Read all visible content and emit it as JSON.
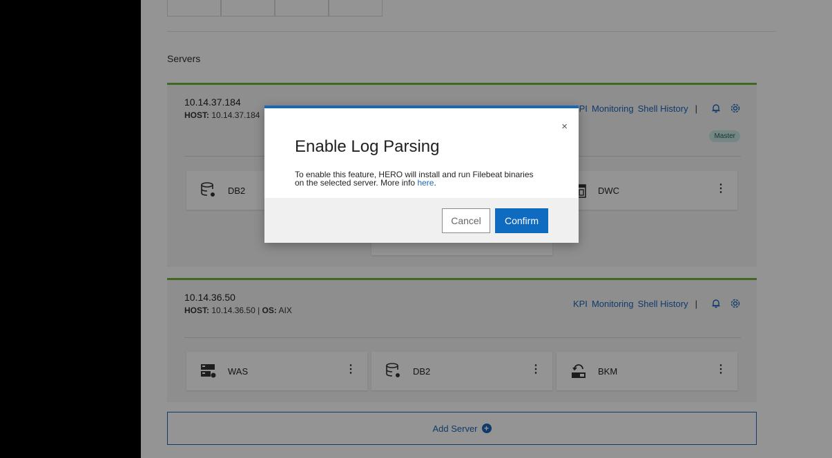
{
  "section_title": "Servers",
  "servers": [
    {
      "ip": "10.14.37.184",
      "host_label": "HOST:",
      "host_value": "10.14.37.184",
      "links": [
        "KPI",
        "Monitoring",
        "Shell History"
      ],
      "separator": "|",
      "badge": "Master",
      "services": [
        {
          "name": "DB2",
          "icon": "database-gear-icon"
        },
        {
          "name": "DWC",
          "icon": "server-panel-icon"
        }
      ]
    },
    {
      "ip": "10.14.36.50",
      "host_label": "HOST:",
      "host_value": "10.14.36.50 |",
      "os_label": "OS:",
      "os_value": "AIX",
      "links": [
        "KPI",
        "Monitoring",
        "Shell History"
      ],
      "separator": "|",
      "services": [
        {
          "name": "WAS",
          "icon": "server-gear-icon"
        },
        {
          "name": "DB2",
          "icon": "database-gear-icon"
        },
        {
          "name": "BKM",
          "icon": "backup-icon"
        }
      ]
    }
  ],
  "add_server": "Add Server",
  "modal": {
    "title": "Enable Log Parsing",
    "body_line1": "To enable this feature, HERO will install and run Filebeat binaries",
    "body_line2": "on the selected server. More info ",
    "link_text": "here",
    "body_end": ".",
    "close": "×",
    "cancel": "Cancel",
    "confirm": "Confirm"
  },
  "colors": {
    "accent": "#1a66b8",
    "card_border": "#6db33f",
    "badge_bg": "#c8e8e3"
  }
}
